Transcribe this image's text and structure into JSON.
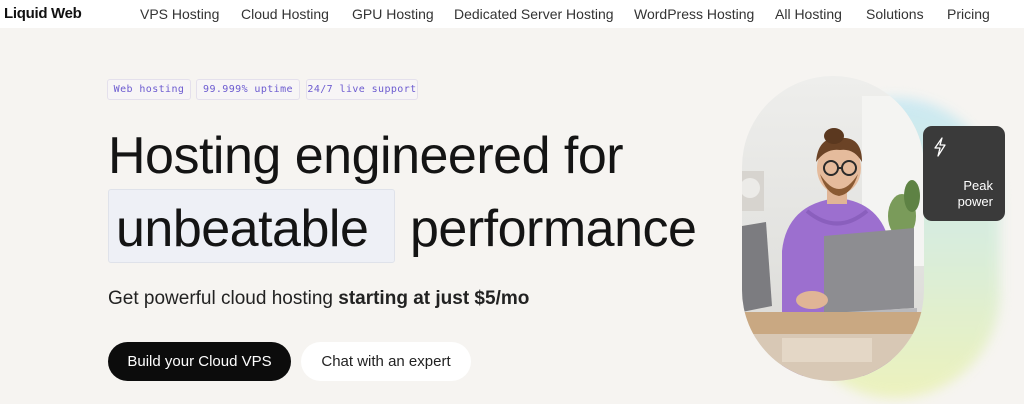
{
  "brand": {
    "logo": "Liquid Web"
  },
  "nav": {
    "items": [
      {
        "label": "VPS Hosting"
      },
      {
        "label": "Cloud Hosting"
      },
      {
        "label": "GPU Hosting"
      },
      {
        "label": "Dedicated Server Hosting"
      },
      {
        "label": "WordPress Hosting"
      },
      {
        "label": "All Hosting"
      },
      {
        "label": "Solutions"
      },
      {
        "label": "Pricing"
      }
    ]
  },
  "hero": {
    "badges": [
      "Web hosting",
      "99.999% uptime",
      "24/7 live support"
    ],
    "headline_line1": "Hosting engineered for",
    "headline_highlight": "unbeatable",
    "headline_line2_rest": "performance",
    "subtext_prefix": "Get powerful cloud hosting",
    "subtext_bold": "starting at just $5/mo",
    "cta_primary": "Build your Cloud VPS",
    "cta_secondary": "Chat with an expert",
    "card_icon": "lightning-bolt-icon",
    "card_line1": "Peak",
    "card_line2": "power"
  },
  "colors": {
    "background": "#f6f4f1",
    "badge_text": "#6c5bd0",
    "primary_button": "#0c0c0c",
    "card_background": "#3a3a3a"
  }
}
